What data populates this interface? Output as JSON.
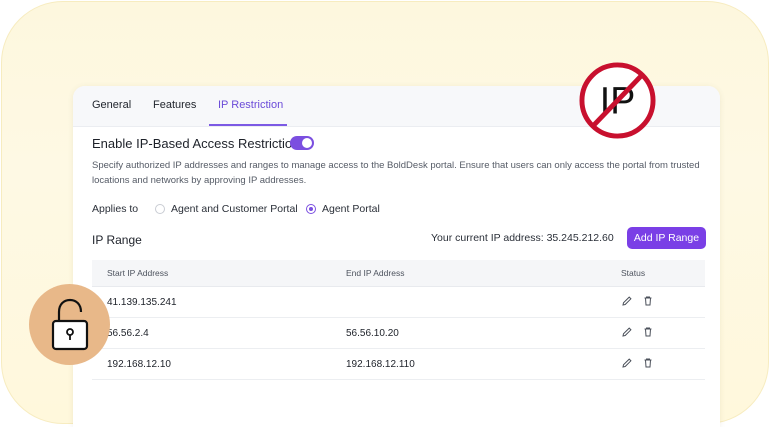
{
  "tabs": [
    {
      "label": "General",
      "active": false
    },
    {
      "label": "Features",
      "active": false
    },
    {
      "label": "IP Restriction",
      "active": true
    }
  ],
  "restriction": {
    "title": "Enable IP-Based Access Restriction",
    "enabled": true,
    "description": "Specify authorized IP addresses and ranges to manage access to the BoldDesk portal. Ensure that users can only access the portal from trusted locations and networks by approving IP addresses."
  },
  "applies_to": {
    "label": "Applies to",
    "options": [
      {
        "label": "Agent and Customer Portal",
        "selected": false
      },
      {
        "label": "Agent Portal",
        "selected": true
      }
    ]
  },
  "ip_range": {
    "title": "IP Range",
    "current_ip_text": "Your current IP address: 35.245.212.60",
    "add_button": "Add IP Range",
    "columns": [
      "Start IP Address",
      "End IP Address",
      "Status"
    ],
    "rows": [
      {
        "start": "41.139.135.241",
        "end": ""
      },
      {
        "start": "56.56.2.4",
        "end": "56.56.10.20"
      },
      {
        "start": "192.168.12.10",
        "end": "192.168.12.110"
      }
    ]
  },
  "badges": {
    "no_ip_text": "IP",
    "no_ip_color": "#c8102e",
    "lock_bg": "#e8b889"
  },
  "colors": {
    "accent": "#7a3fe6",
    "tab_active": "#6b4bd8"
  },
  "icons": [
    "edit-icon",
    "delete-icon",
    "no-ip-icon",
    "lock-icon"
  ]
}
